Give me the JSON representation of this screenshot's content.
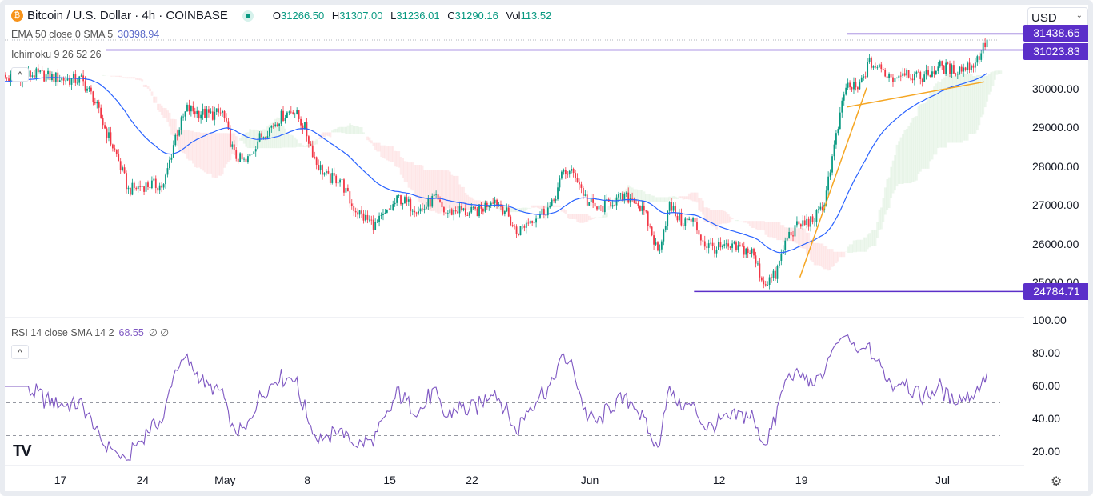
{
  "header": {
    "symbol": "Bitcoin / U.S. Dollar · 4h · COINBASE",
    "o_label": "O",
    "o": "31266.50",
    "h_label": "H",
    "h": "31307.00",
    "l_label": "L",
    "l": "31236.01",
    "c_label": "C",
    "c": "31290.16",
    "vol_label": "Vol",
    "vol": "113.52"
  },
  "indicators": {
    "ema_label": "EMA 50 close 0 SMA 5",
    "ema_value": "30398.94",
    "ichimoku_label": "Ichimoku 9 26 52 26",
    "rsi_label": "RSI 14 close SMA 14 2",
    "rsi_value": "68.55",
    "rsi_extra": "∅ ∅"
  },
  "currency": "USD",
  "price_labels": [
    "31438.65",
    "31023.83",
    "24784.71"
  ],
  "colors": {
    "up": "#089981",
    "down": "#f23645",
    "ema": "#2962ff",
    "rsi": "#7e57c2",
    "level": "#5b2fc9",
    "trend": "#f5a623"
  },
  "chart_data": [
    {
      "type": "candlestick",
      "title": "Bitcoin / U.S. Dollar · 4h · COINBASE",
      "ylabel": "USD",
      "ylim": [
        24700,
        31700
      ],
      "yticks": [
        "30000.00",
        "29000.00",
        "28000.00",
        "27000.00",
        "26000.00",
        "25000.00"
      ],
      "xticks": [
        {
          "label": "17",
          "date": "Apr 17"
        },
        {
          "label": "24",
          "date": "Apr 24"
        },
        {
          "label": "May",
          "date": "May 1"
        },
        {
          "label": "8",
          "date": "May 8"
        },
        {
          "label": "15",
          "date": "May 15"
        },
        {
          "label": "22",
          "date": "May 22"
        },
        {
          "label": "Jun",
          "date": "Jun 1"
        },
        {
          "label": "12",
          "date": "Jun 12"
        },
        {
          "label": "19",
          "date": "Jun 19"
        },
        {
          "label": "Jul",
          "date": "Jul 1"
        }
      ],
      "dates": [
        "Apr 12",
        "Apr 13",
        "Apr 14",
        "Apr 15",
        "Apr 16",
        "Apr 17",
        "Apr 18",
        "Apr 19",
        "Apr 20",
        "Apr 21",
        "Apr 22",
        "Apr 23",
        "Apr 24",
        "Apr 25",
        "Apr 26",
        "Apr 27",
        "Apr 28",
        "Apr 29",
        "Apr 30",
        "May 1",
        "May 2",
        "May 3",
        "May 4",
        "May 5",
        "May 6",
        "May 7",
        "May 8",
        "May 9",
        "May 10",
        "May 11",
        "May 12",
        "May 13",
        "May 14",
        "May 15",
        "May 16",
        "May 17",
        "May 18",
        "May 19",
        "May 20",
        "May 21",
        "May 22",
        "May 23",
        "May 24",
        "May 25",
        "May 26",
        "May 27",
        "May 28",
        "May 29",
        "May 30",
        "May 31",
        "Jun 1",
        "Jun 2",
        "Jun 3",
        "Jun 4",
        "Jun 5",
        "Jun 6",
        "Jun 7",
        "Jun 8",
        "Jun 9",
        "Jun 10",
        "Jun 11",
        "Jun 12",
        "Jun 13",
        "Jun 14",
        "Jun 15",
        "Jun 16",
        "Jun 17",
        "Jun 18",
        "Jun 19",
        "Jun 20",
        "Jun 21",
        "Jun 22",
        "Jun 23",
        "Jun 24",
        "Jun 25",
        "Jun 26",
        "Jun 27",
        "Jun 28",
        "Jun 29",
        "Jun 30",
        "Jul 1",
        "Jul 2",
        "Jul 3",
        "Jul 4"
      ],
      "daily_close": [
        30300,
        30350,
        30400,
        30350,
        30300,
        30250,
        30250,
        29800,
        29000,
        28300,
        27400,
        27500,
        27550,
        27500,
        28800,
        29500,
        29400,
        29350,
        29400,
        28300,
        28100,
        28700,
        29000,
        29300,
        29500,
        29000,
        28100,
        27700,
        27700,
        27000,
        26700,
        26500,
        26800,
        27200,
        27000,
        26900,
        27200,
        26800,
        26900,
        26800,
        26900,
        27200,
        26900,
        26300,
        26600,
        26800,
        27000,
        27900,
        27800,
        27100,
        26900,
        27100,
        27200,
        27200,
        26700,
        25800,
        27000,
        26600,
        26600,
        26000,
        25900,
        25900,
        25900,
        25800,
        25000,
        25200,
        26200,
        26500,
        26600,
        26900,
        28500,
        30100,
        30000,
        30700,
        30500,
        30300,
        30500,
        30300,
        30400,
        30600,
        30500,
        30550,
        30700,
        31290
      ],
      "levels": [
        {
          "price": 31438.65,
          "from": "Jun 23"
        },
        {
          "price": 31023.83,
          "from": "Apr 21"
        },
        {
          "price": 24784.71,
          "from": "Jun 10"
        }
      ],
      "trendlines": [
        {
          "from": [
            "Jun 19",
            25150
          ],
          "to": [
            "Jun 24",
            30050
          ]
        },
        {
          "from": [
            "Jun 23",
            29550
          ],
          "to": [
            "Jul 4",
            30200
          ]
        }
      ]
    },
    {
      "type": "line",
      "title": "RSI 14 close SMA 14 2",
      "ylim": [
        15,
        100
      ],
      "yticks": [
        "100.00",
        "80.00",
        "60.00",
        "40.00",
        "20.00"
      ],
      "bands": [
        70,
        50,
        30
      ],
      "last": 68.55
    }
  ]
}
